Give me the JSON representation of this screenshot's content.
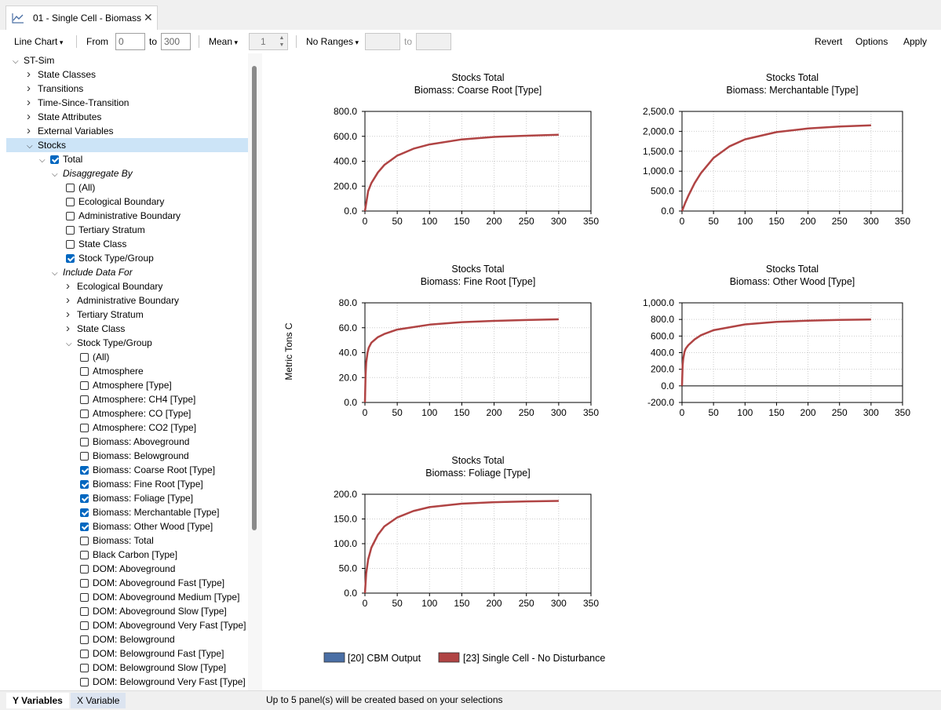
{
  "tab": {
    "title": "01 - Single Cell - Biomass"
  },
  "toolbar": {
    "chart_type": "Line Chart",
    "from_label": "From",
    "from_value": "0",
    "to_label": "to",
    "to_value": "300",
    "aggregate": "Mean",
    "aggregate_value": "1",
    "ranges": "No Ranges",
    "ranges_to": "to",
    "revert": "Revert",
    "options": "Options",
    "apply": "Apply"
  },
  "tree": [
    {
      "label": "ST-Sim",
      "depth": 0,
      "expander": "open"
    },
    {
      "label": "State Classes",
      "depth": 1,
      "expander": "closed"
    },
    {
      "label": "Transitions",
      "depth": 1,
      "expander": "closed"
    },
    {
      "label": "Time-Since-Transition",
      "depth": 1,
      "expander": "closed"
    },
    {
      "label": "State Attributes",
      "depth": 1,
      "expander": "closed"
    },
    {
      "label": "External Variables",
      "depth": 1,
      "expander": "closed"
    },
    {
      "label": "Stocks",
      "depth": 1,
      "expander": "open",
      "selected": true
    },
    {
      "label": "Total",
      "depth": 2,
      "expander": "open",
      "check": "checked"
    },
    {
      "label": "Disaggregate By",
      "depth": 3,
      "expander": "open",
      "italic": true
    },
    {
      "label": "(All)",
      "depth": 4,
      "check": "unchecked"
    },
    {
      "label": "Ecological Boundary",
      "depth": 4,
      "check": "unchecked"
    },
    {
      "label": "Administrative Boundary",
      "depth": 4,
      "check": "unchecked"
    },
    {
      "label": "Tertiary Stratum",
      "depth": 4,
      "check": "unchecked"
    },
    {
      "label": "State Class",
      "depth": 4,
      "check": "unchecked"
    },
    {
      "label": "Stock Type/Group",
      "depth": 4,
      "check": "checked"
    },
    {
      "label": "Include Data For",
      "depth": 3,
      "expander": "open",
      "italic": true
    },
    {
      "label": "Ecological Boundary",
      "depth": 4,
      "expander": "closed"
    },
    {
      "label": "Administrative Boundary",
      "depth": 4,
      "expander": "closed"
    },
    {
      "label": "Tertiary Stratum",
      "depth": 4,
      "expander": "closed"
    },
    {
      "label": "State Class",
      "depth": 4,
      "expander": "closed"
    },
    {
      "label": "Stock Type/Group",
      "depth": 4,
      "expander": "open"
    },
    {
      "label": "(All)",
      "depth": 5,
      "check": "unchecked"
    },
    {
      "label": "Atmosphere",
      "depth": 5,
      "check": "unchecked"
    },
    {
      "label": "Atmosphere [Type]",
      "depth": 5,
      "check": "unchecked"
    },
    {
      "label": "Atmosphere: CH4 [Type]",
      "depth": 5,
      "check": "unchecked"
    },
    {
      "label": "Atmosphere: CO [Type]",
      "depth": 5,
      "check": "unchecked"
    },
    {
      "label": "Atmosphere: CO2 [Type]",
      "depth": 5,
      "check": "unchecked"
    },
    {
      "label": "Biomass: Aboveground",
      "depth": 5,
      "check": "unchecked"
    },
    {
      "label": "Biomass: Belowground",
      "depth": 5,
      "check": "unchecked"
    },
    {
      "label": "Biomass: Coarse Root [Type]",
      "depth": 5,
      "check": "checked"
    },
    {
      "label": "Biomass: Fine Root [Type]",
      "depth": 5,
      "check": "checked"
    },
    {
      "label": "Biomass: Foliage [Type]",
      "depth": 5,
      "check": "checked"
    },
    {
      "label": "Biomass: Merchantable [Type]",
      "depth": 5,
      "check": "checked"
    },
    {
      "label": "Biomass: Other Wood [Type]",
      "depth": 5,
      "check": "checked"
    },
    {
      "label": "Biomass: Total",
      "depth": 5,
      "check": "unchecked"
    },
    {
      "label": "Black Carbon [Type]",
      "depth": 5,
      "check": "unchecked"
    },
    {
      "label": "DOM: Aboveground",
      "depth": 5,
      "check": "unchecked"
    },
    {
      "label": "DOM: Aboveground Fast [Type]",
      "depth": 5,
      "check": "unchecked"
    },
    {
      "label": "DOM: Aboveground Medium [Type]",
      "depth": 5,
      "check": "unchecked"
    },
    {
      "label": "DOM: Aboveground Slow [Type]",
      "depth": 5,
      "check": "unchecked"
    },
    {
      "label": "DOM: Aboveground Very Fast [Type]",
      "depth": 5,
      "check": "unchecked"
    },
    {
      "label": "DOM: Belowground",
      "depth": 5,
      "check": "unchecked"
    },
    {
      "label": "DOM: Belowground Fast [Type]",
      "depth": 5,
      "check": "unchecked"
    },
    {
      "label": "DOM: Belowground Slow [Type]",
      "depth": 5,
      "check": "unchecked"
    },
    {
      "label": "DOM: Belowground Very Fast [Type]",
      "depth": 5,
      "check": "unchecked"
    }
  ],
  "y_axis_label": "Metric Tons C",
  "legend": [
    {
      "name": "[20] CBM Output",
      "color": "#4a6fa5"
    },
    {
      "name": "[23] Single Cell - No Disturbance",
      "color": "#b04444"
    }
  ],
  "chart_data": [
    {
      "type": "line",
      "title": "Stocks Total",
      "subtitle": "Biomass: Coarse Root [Type]",
      "xlim": [
        0,
        350
      ],
      "ylim": [
        0,
        800
      ],
      "xticks": [
        0,
        50,
        100,
        150,
        200,
        250,
        300,
        350
      ],
      "yticks": [
        0,
        200,
        400,
        600,
        800
      ],
      "ytick_labels": [
        "0.0",
        "200.0",
        "400.0",
        "600.0",
        "800.0"
      ],
      "x": [
        0,
        5,
        10,
        20,
        30,
        50,
        75,
        100,
        150,
        200,
        250,
        300
      ],
      "y": [
        0,
        160,
        225,
        310,
        370,
        445,
        500,
        535,
        575,
        595,
        605,
        612
      ]
    },
    {
      "type": "line",
      "title": "Stocks Total",
      "subtitle": "Biomass: Merchantable [Type]",
      "xlim": [
        0,
        350
      ],
      "ylim": [
        0,
        2500
      ],
      "xticks": [
        0,
        50,
        100,
        150,
        200,
        250,
        300,
        350
      ],
      "yticks": [
        0,
        500,
        1000,
        1500,
        2000,
        2500
      ],
      "ytick_labels": [
        "0.0",
        "500.0",
        "1,000.0",
        "1,500.0",
        "2,000.0",
        "2,500.0"
      ],
      "x": [
        0,
        5,
        10,
        20,
        30,
        50,
        75,
        100,
        150,
        200,
        250,
        300
      ],
      "y": [
        0,
        200,
        380,
        700,
        950,
        1330,
        1620,
        1800,
        1980,
        2070,
        2120,
        2150
      ]
    },
    {
      "type": "line",
      "title": "Stocks Total",
      "subtitle": "Biomass: Fine Root [Type]",
      "xlim": [
        0,
        350
      ],
      "ylim": [
        0,
        80
      ],
      "xticks": [
        0,
        50,
        100,
        150,
        200,
        250,
        300,
        350
      ],
      "yticks": [
        0,
        20,
        40,
        60,
        80
      ],
      "ytick_labels": [
        "0.0",
        "20.0",
        "40.0",
        "60.0",
        "80.0"
      ],
      "x": [
        0,
        1,
        2,
        4,
        6,
        10,
        20,
        30,
        50,
        100,
        150,
        200,
        250,
        300
      ],
      "y": [
        0,
        22,
        32,
        40,
        44,
        48,
        52.5,
        55,
        58.5,
        62.5,
        64.5,
        65.5,
        66.2,
        66.8
      ]
    },
    {
      "type": "line",
      "title": "Stocks Total",
      "subtitle": "Biomass: Other Wood [Type]",
      "xlim": [
        0,
        350
      ],
      "ylim": [
        -200,
        1000
      ],
      "xticks": [
        0,
        50,
        100,
        150,
        200,
        250,
        300,
        350
      ],
      "yticks": [
        -200,
        0,
        200,
        400,
        600,
        800,
        1000
      ],
      "ytick_labels": [
        "-200.0",
        "0.0",
        "200.0",
        "400.0",
        "600.0",
        "800.0",
        "1,000.0"
      ],
      "x": [
        0,
        1,
        2,
        4,
        6,
        10,
        20,
        30,
        50,
        100,
        150,
        200,
        250,
        300
      ],
      "y": [
        0,
        250,
        330,
        410,
        450,
        490,
        560,
        610,
        670,
        740,
        770,
        785,
        795,
        800
      ]
    },
    {
      "type": "line",
      "title": "Stocks Total",
      "subtitle": "Biomass: Foliage [Type]",
      "xlim": [
        0,
        350
      ],
      "ylim": [
        0,
        200
      ],
      "xticks": [
        0,
        50,
        100,
        150,
        200,
        250,
        300,
        350
      ],
      "yticks": [
        0,
        50,
        100,
        150,
        200
      ],
      "ytick_labels": [
        "0.0",
        "50.0",
        "100.0",
        "150.0",
        "200.0"
      ],
      "x": [
        0,
        2,
        5,
        10,
        20,
        30,
        50,
        75,
        100,
        150,
        200,
        250,
        300
      ],
      "y": [
        0,
        40,
        68,
        92,
        118,
        135,
        153,
        166,
        174,
        181,
        184,
        185.5,
        186.5
      ]
    }
  ],
  "bottom_tabs": {
    "y_variables": "Y Variables",
    "x_variable": "X Variable"
  },
  "status": "Up to 5 panel(s) will be created based on your selections"
}
